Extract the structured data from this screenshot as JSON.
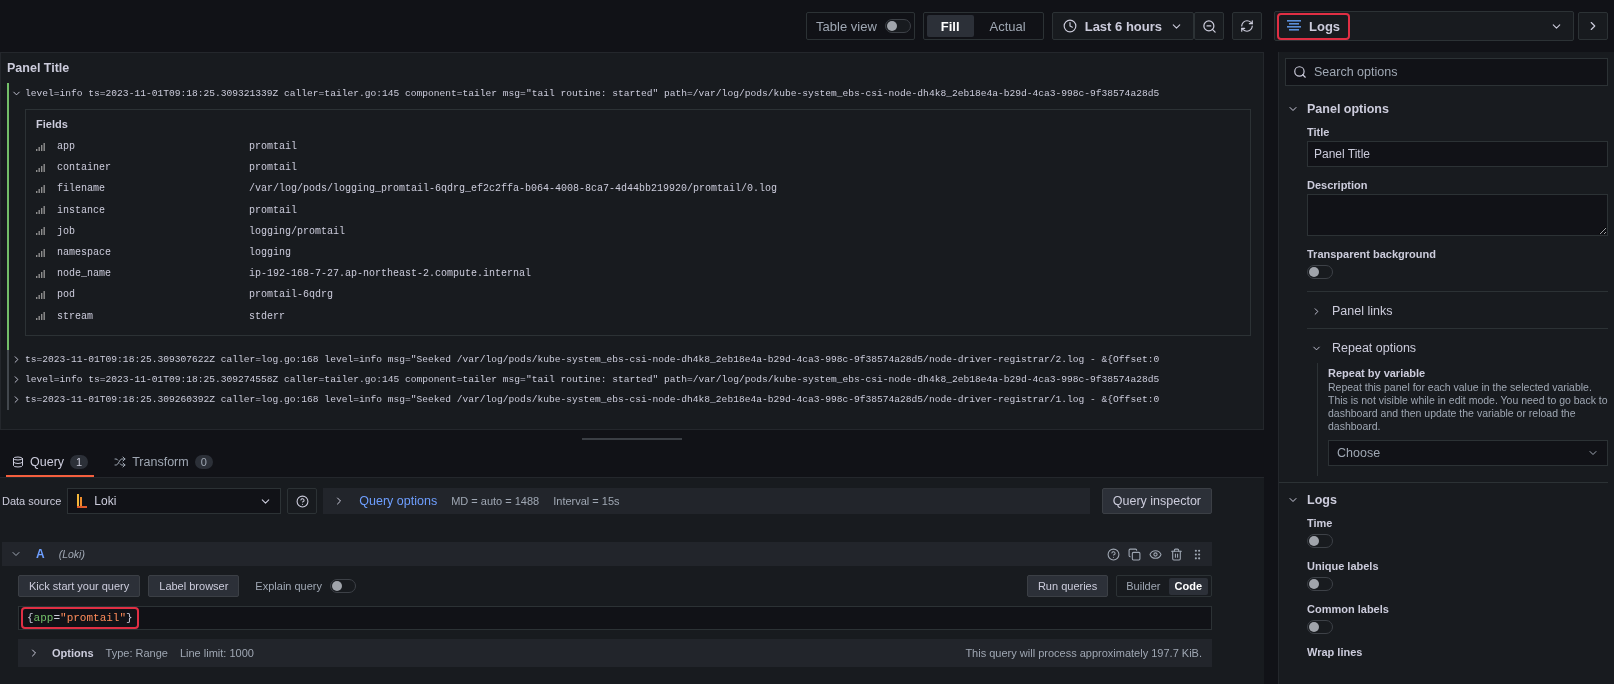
{
  "toolbar": {
    "table_view": {
      "label": "Table view",
      "on": false
    },
    "size_modes": [
      {
        "label": "Fill",
        "selected": true
      },
      {
        "label": "Actual",
        "selected": false
      }
    ],
    "time_range": "Last 6 hours"
  },
  "visualization_picker": {
    "label": "Logs",
    "highlighted": true
  },
  "panel": {
    "title": "Panel Title",
    "log_lines": [
      {
        "text": "level=info ts=2023-11-01T09:18:25.309321339Z caller=tailer.go:145 component=tailer msg=\"tail routine: started\" path=/var/log/pods/kube-system_ebs-csi-node-dh4k8_2eb18e4a-b29d-4ca3-998c-9f38574a28d5",
        "expanded": true,
        "fields_title": "Fields",
        "fields": [
          {
            "key": "app",
            "value": "promtail"
          },
          {
            "key": "container",
            "value": "promtail"
          },
          {
            "key": "filename",
            "value": "/var/log/pods/logging_promtail-6qdrg_ef2c2ffa-b064-4008-8ca7-4d44bb219920/promtail/0.log"
          },
          {
            "key": "instance",
            "value": "promtail"
          },
          {
            "key": "job",
            "value": "logging/promtail"
          },
          {
            "key": "namespace",
            "value": "logging"
          },
          {
            "key": "node_name",
            "value": "ip-192-168-7-27.ap-northeast-2.compute.internal"
          },
          {
            "key": "pod",
            "value": "promtail-6qdrg"
          },
          {
            "key": "stream",
            "value": "stderr"
          }
        ]
      },
      {
        "text": "ts=2023-11-01T09:18:25.309307622Z caller=log.go:168 level=info msg=\"Seeked /var/log/pods/kube-system_ebs-csi-node-dh4k8_2eb18e4a-b29d-4ca3-998c-9f38574a28d5/node-driver-registrar/2.log - &{Offset:0",
        "expanded": false
      },
      {
        "text": "level=info ts=2023-11-01T09:18:25.309274558Z caller=tailer.go:145 component=tailer msg=\"tail routine: started\" path=/var/log/pods/kube-system_ebs-csi-node-dh4k8_2eb18e4a-b29d-4ca3-998c-9f38574a28d5",
        "expanded": false
      },
      {
        "text": "ts=2023-11-01T09:18:25.309260392Z caller=log.go:168 level=info msg=\"Seeked /var/log/pods/kube-system_ebs-csi-node-dh4k8_2eb18e4a-b29d-4ca3-998c-9f38574a28d5/node-driver-registrar/1.log - &{Offset:0",
        "expanded": false
      }
    ]
  },
  "query_tabs": [
    {
      "label": "Query",
      "count": "1",
      "selected": true
    },
    {
      "label": "Transform",
      "count": "0",
      "selected": false
    }
  ],
  "data_source": {
    "label": "Data source",
    "value": "Loki"
  },
  "query_options": {
    "label": "Query options",
    "md": "MD = auto = 1488",
    "interval": "Interval = 15s"
  },
  "query_inspector": "Query inspector",
  "query": {
    "ref": "A",
    "datasource": "(Loki)",
    "expanded": true,
    "buttons": [
      "Kick start your query",
      "Label browser"
    ],
    "explain": {
      "label": "Explain query",
      "on": false
    },
    "run": "Run queries",
    "modes": [
      {
        "label": "Builder",
        "selected": false
      },
      {
        "label": "Code",
        "selected": true
      }
    ],
    "highlighted": true,
    "expr_parts": [
      {
        "kind": "punct",
        "text": "{"
      },
      {
        "kind": "label",
        "text": "app"
      },
      {
        "kind": "punct",
        "text": "="
      },
      {
        "kind": "string",
        "text": "\"promtail\""
      },
      {
        "kind": "punct",
        "text": "}"
      }
    ],
    "options": {
      "label": "Options",
      "expanded": false,
      "type": "Type: Range",
      "limit": "Line limit: 1000",
      "estimate": "This query will process approximately 197.7 KiB."
    }
  },
  "options_pane": {
    "search_placeholder": "Search options",
    "sections": [
      {
        "title": "Panel options",
        "expanded": true,
        "items": [
          {
            "kind": "input",
            "label": "Title",
            "value": "Panel Title"
          },
          {
            "kind": "textarea",
            "label": "Description"
          },
          {
            "kind": "switch",
            "label": "Transparent background",
            "on": false
          },
          {
            "kind": "group",
            "label": "Panel links",
            "expanded": false
          },
          {
            "kind": "group",
            "label": "Repeat options",
            "expanded": true,
            "field": "Repeat by variable",
            "description": "Repeat this panel for each value in the selected variable. This is not visible while in edit mode. You need to go back to dashboard and then update the variable or reload the dashboard.",
            "placeholder": "Choose"
          }
        ]
      },
      {
        "title": "Logs",
        "expanded": true,
        "items": [
          {
            "kind": "switch",
            "label": "Time",
            "on": false
          },
          {
            "kind": "switch",
            "label": "Unique labels",
            "on": false
          },
          {
            "kind": "switch",
            "label": "Common labels",
            "on": false
          },
          {
            "kind": "heading",
            "label": "Wrap lines"
          }
        ]
      }
    ]
  }
}
